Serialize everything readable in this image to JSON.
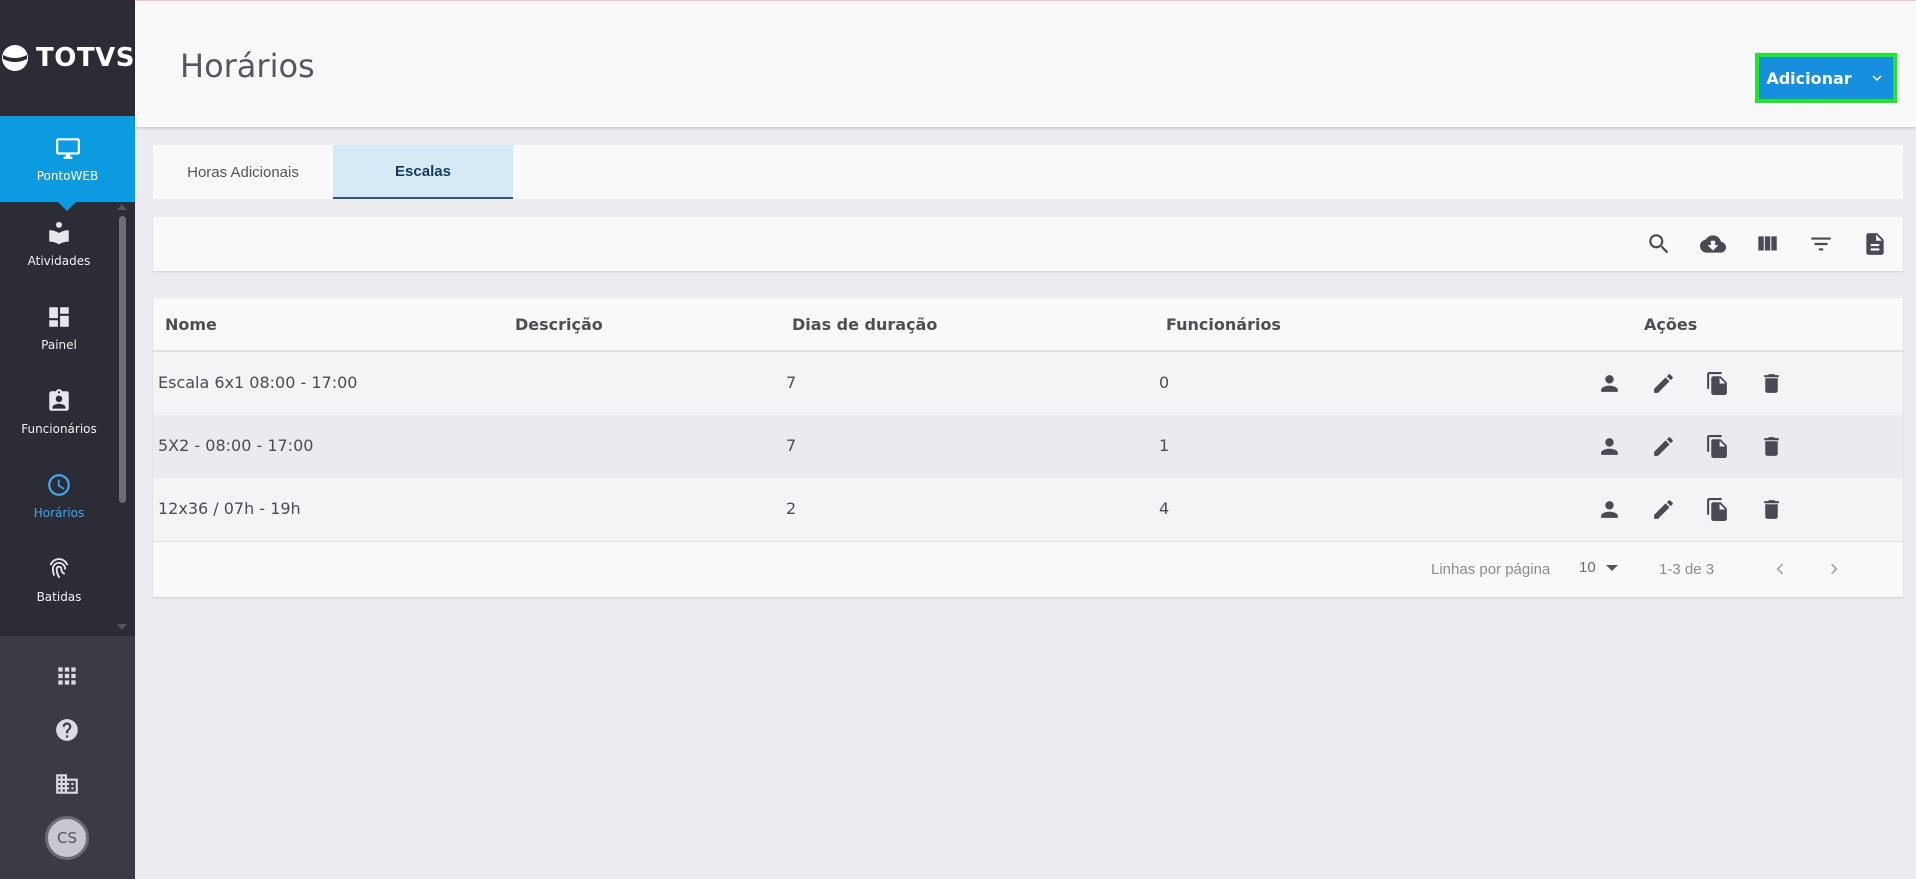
{
  "brand": {
    "logo_text": "TOTVS"
  },
  "sidebar": {
    "product": {
      "label": "PontoWEB",
      "icon": "monitor-icon"
    },
    "items": [
      {
        "label": "Atividades",
        "icon": "reading-icon"
      },
      {
        "label": "Painel",
        "icon": "dashboard-icon"
      },
      {
        "label": "Funcionários",
        "icon": "badge-icon"
      },
      {
        "label": "Horários",
        "icon": "clock-icon"
      },
      {
        "label": "Batidas",
        "icon": "fingerprint-icon"
      }
    ],
    "bottom": {
      "apps_icon": "apps-grid-icon",
      "help_icon": "help-icon",
      "company_icon": "building-icon",
      "avatar_initials": "CS"
    }
  },
  "header": {
    "title": "Horários",
    "add_button_label": "Adicionar"
  },
  "tabs": [
    {
      "label": "Horas Adicionais"
    },
    {
      "label": "Escalas"
    }
  ],
  "toolbar": {
    "icons": [
      "search-icon",
      "download-cloud-icon",
      "columns-icon",
      "filter-icon",
      "report-icon"
    ]
  },
  "table": {
    "headers": [
      "Nome",
      "Descrição",
      "Dias de duração",
      "Funcionários",
      "Ações"
    ],
    "rows": [
      {
        "nome": "Escala 6x1 08:00 - 17:00",
        "descricao": "",
        "dias": "7",
        "funcionarios": "0"
      },
      {
        "nome": "5X2 - 08:00 - 17:00",
        "descricao": "",
        "dias": "7",
        "funcionarios": "1"
      },
      {
        "nome": "12x36 / 07h - 19h",
        "descricao": "",
        "dias": "2",
        "funcionarios": "4"
      }
    ],
    "footer": {
      "rows_per_page_label": "Linhas por página",
      "rows_per_page_value": "10",
      "range_text": "1-3 de 3"
    }
  },
  "colors": {
    "brand_blue": "#0c9be0",
    "active_nav": "#3ea8f0",
    "button_blue": "#1690de",
    "highlight_border": "#22e62a",
    "sidebar_bg": "#2c2c36"
  }
}
